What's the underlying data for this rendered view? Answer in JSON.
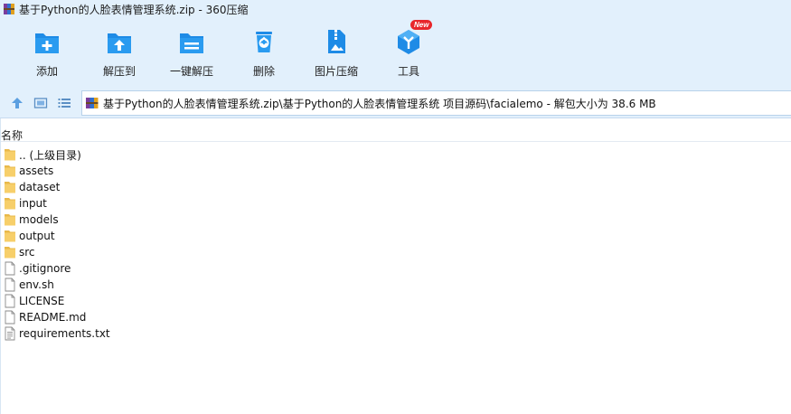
{
  "window": {
    "title": "基于Python的人脸表情管理系统.zip - 360压缩"
  },
  "toolbar": {
    "add_label": "添加",
    "extract_to_label": "解压到",
    "one_click_extract_label": "一键解压",
    "delete_label": "删除",
    "image_compress_label": "图片压缩",
    "tools_label": "工具",
    "tools_badge": "New"
  },
  "address": {
    "path": "基于Python的人脸表情管理系统.zip\\基于Python的人脸表情管理系统 项目源码\\facialemo - 解包大小为 38.6 MB"
  },
  "columns": {
    "name": "名称"
  },
  "files": [
    {
      "name": ".. (上级目录)",
      "type": "folder"
    },
    {
      "name": "assets",
      "type": "folder"
    },
    {
      "name": "dataset",
      "type": "folder"
    },
    {
      "name": "input",
      "type": "folder"
    },
    {
      "name": "models",
      "type": "folder"
    },
    {
      "name": "output",
      "type": "folder"
    },
    {
      "name": "src",
      "type": "folder"
    },
    {
      "name": ".gitignore",
      "type": "file"
    },
    {
      "name": "env.sh",
      "type": "file"
    },
    {
      "name": "LICENSE",
      "type": "file"
    },
    {
      "name": "README.md",
      "type": "file"
    },
    {
      "name": "requirements.txt",
      "type": "text-file"
    }
  ],
  "colors": {
    "toolbar_bg": "#e2f0fc",
    "icon_blue": "#1e8be6",
    "folder_yellow": "#f7cf6a",
    "badge_red": "#e8262b"
  },
  "icons": {
    "app": "winrar-zip-icon",
    "add": "add-icon",
    "extract_to": "extract-to-icon",
    "one_click_extract": "one-click-extract-icon",
    "delete": "recycle-icon",
    "image_compress": "image-zip-icon",
    "tools": "tools-cube-icon",
    "up": "up-arrow-icon",
    "view_thumbnails": "thumbnail-view-icon",
    "view_list": "list-view-icon"
  }
}
